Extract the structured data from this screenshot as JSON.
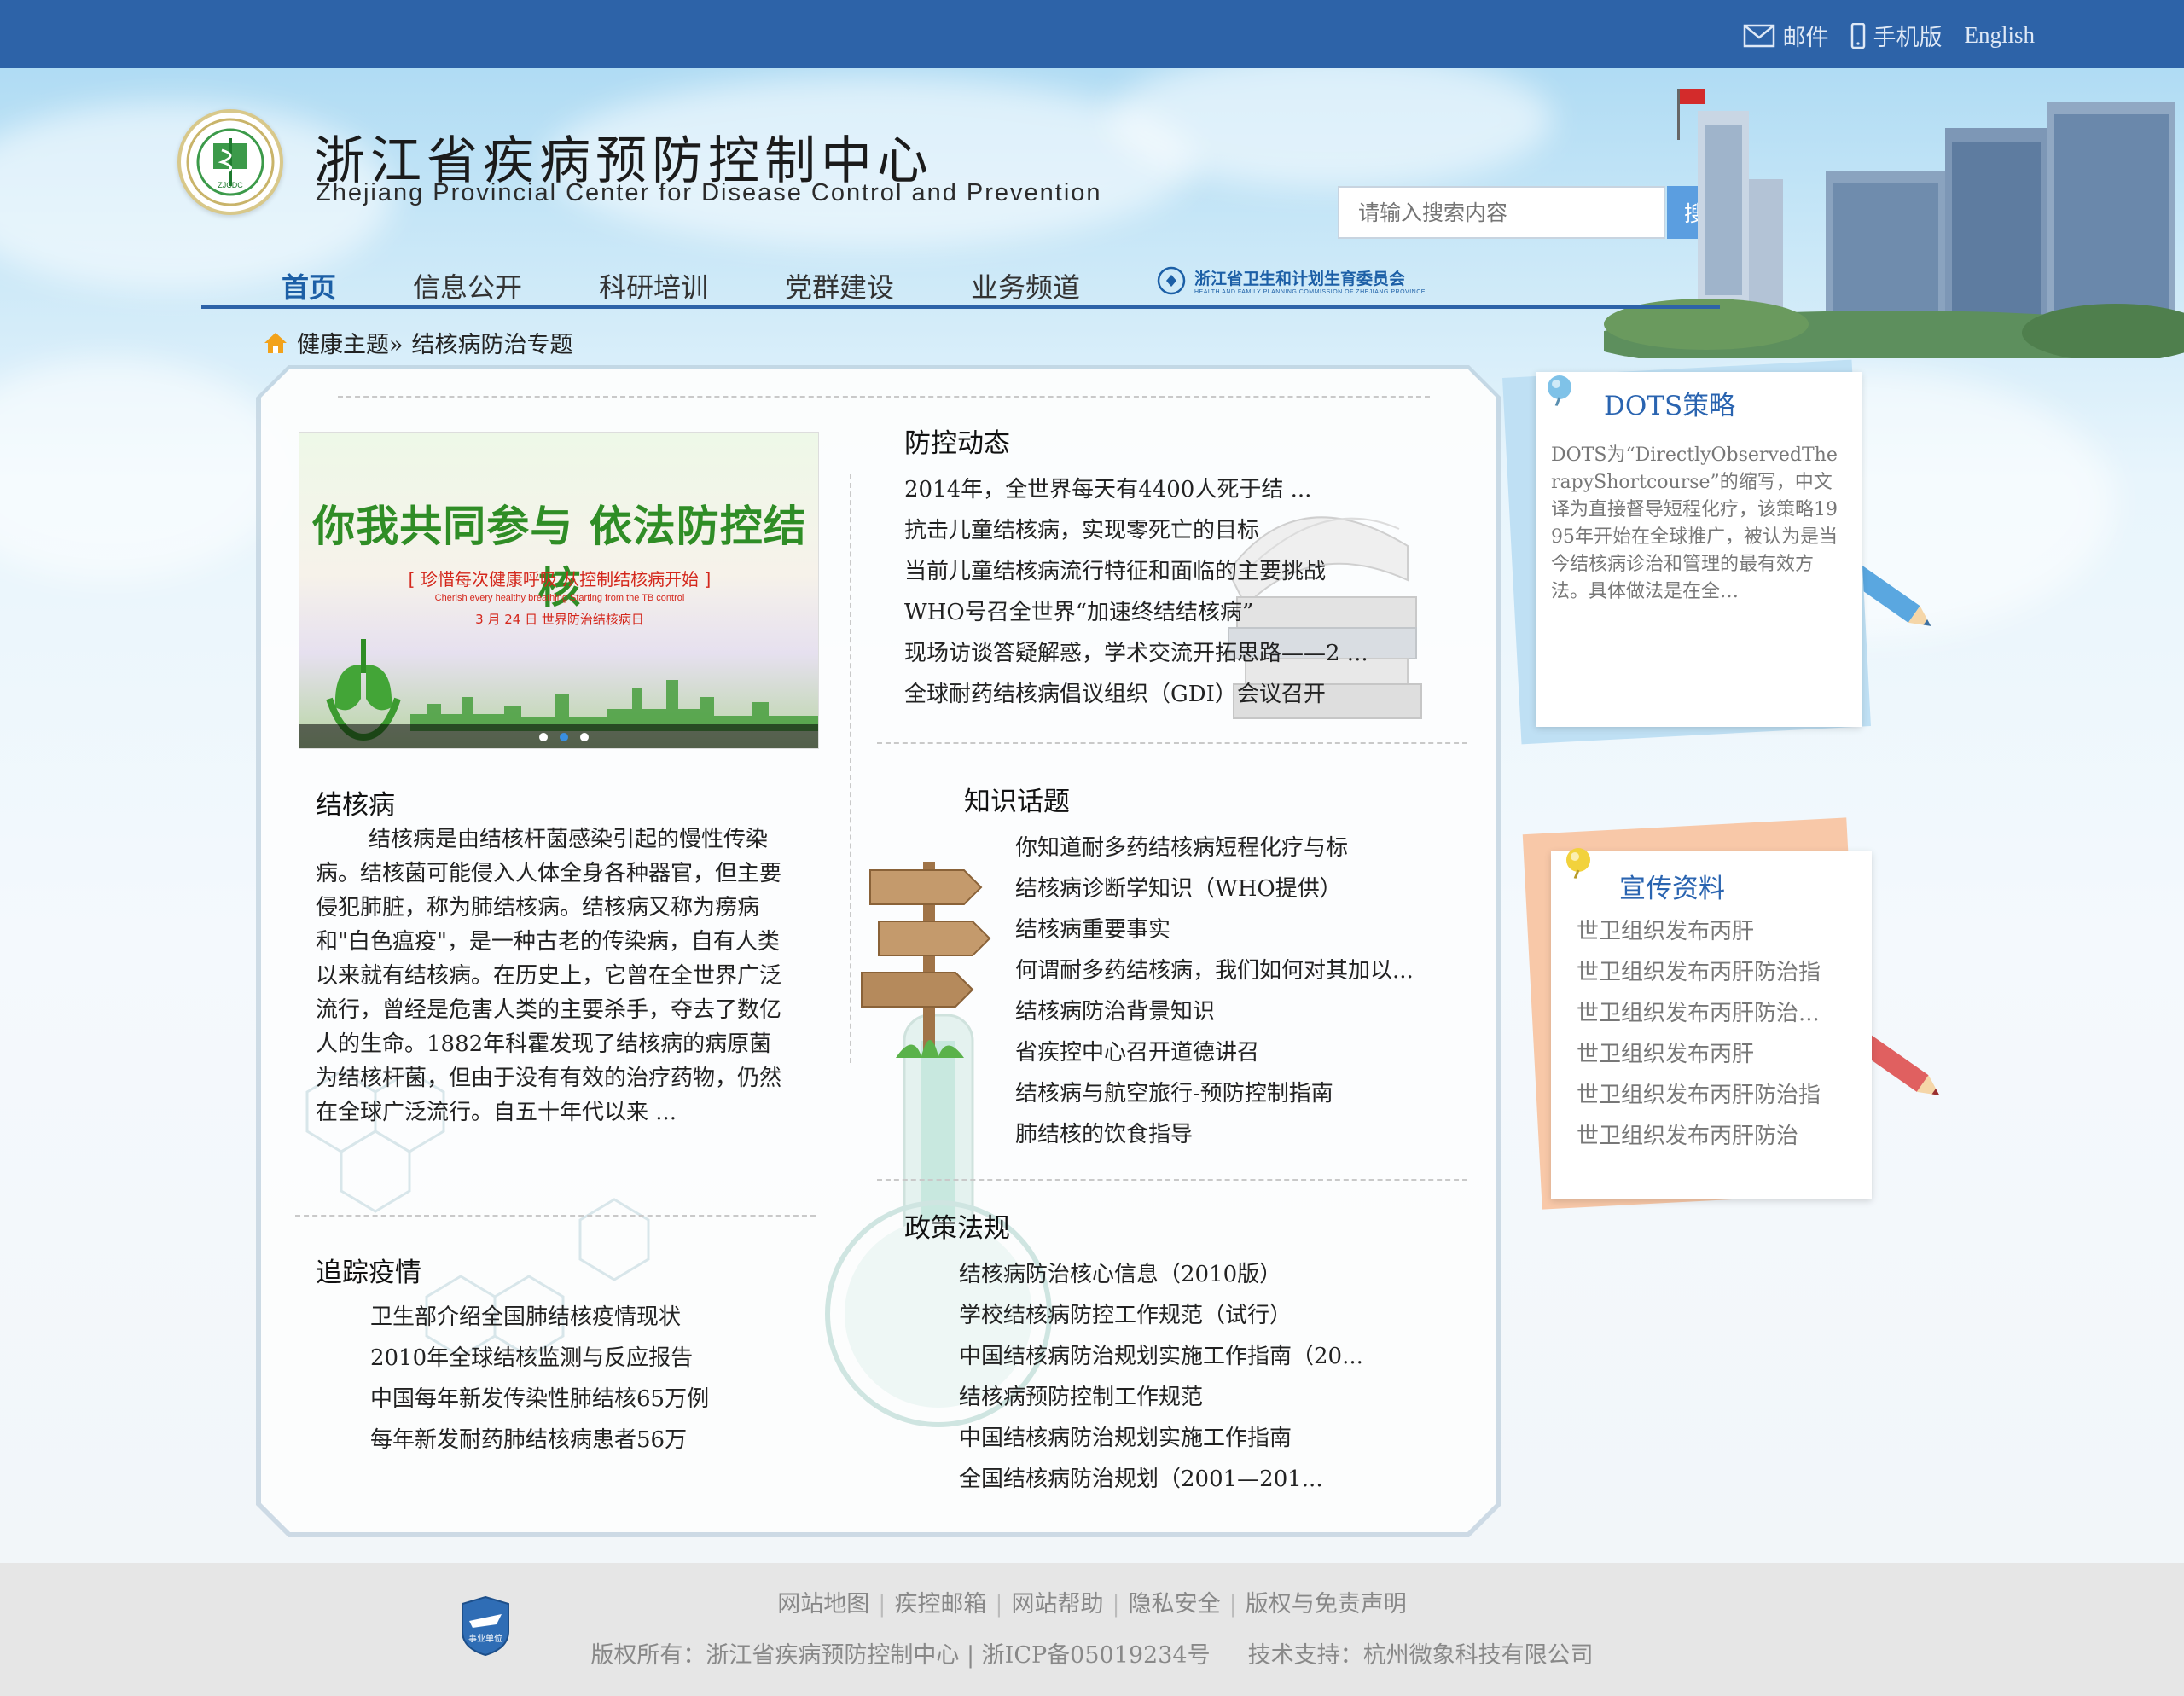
{
  "header": {
    "top_links": {
      "mail": "邮件",
      "mobile": "手机版",
      "english": "English"
    },
    "title_cn": "浙江省疾病预防控制中心",
    "title_en": "Zhejiang Provincial Center for Disease Control and Prevention",
    "logo_text": "ZJCDC",
    "search": {
      "placeholder": "请输入搜索内容",
      "button": "搜索"
    }
  },
  "nav": {
    "items": [
      "首页",
      "信息公开",
      "科研培训",
      "党群建设",
      "业务频道"
    ],
    "active_index": 0,
    "commission_cn": "浙江省卫生和计划生育委员会",
    "commission_en": "HEALTH AND FAMILY PLANNING COMMISSION OF ZHEJIANG PROVINCE"
  },
  "breadcrumb": {
    "parent": "健康主题»",
    "current": "结核病防治专题"
  },
  "banner": {
    "title": "你我共同参与 依法防控结核",
    "subtitle": "[ 珍惜每次健康呼吸  从控制结核病开始 ]",
    "subtitle_en": "Cherish every healthy breathing Starting from the TB control",
    "date": "3 月 24 日 世界防治结核病日"
  },
  "tb_intro": {
    "title": "结核病",
    "text": "结核病是由结核杆菌感染引起的慢性传染病。结核菌可能侵入人体全身各种器官，但主要侵犯肺脏，称为肺结核病。结核病又称为痨病和\"白色瘟疫\"，是一种古老的传染病，自有人类以来就有结核病。在历史上，它曾在全世界广泛流行，曾经是危害人类的主要杀手，夺去了数亿人的生命。1882年科霍发现了结核病的病原菌为结核杆菌，但由于没有有效的治疗药物，仍然在全球广泛流行。自五十年代以来 ..."
  },
  "epidemic": {
    "title": "追踪疫情",
    "items": [
      "卫生部介绍全国肺结核疫情现状",
      "2010年全球结核监测与反应报告",
      "中国每年新发传染性肺结核65万例",
      "每年新发耐药肺结核病患者56万"
    ]
  },
  "news": {
    "title": "防控动态",
    "items": [
      "2014年，全世界每天有4400人死于结 ...",
      "抗击儿童结核病，实现零死亡的目标",
      "当前儿童结核病流行特征和面临的主要挑战",
      "WHO号召全世界“加速终结结核病”",
      "现场访谈答疑解惑，学术交流开拓思路——2 ...",
      "全球耐药结核病倡议组织（GDI）会议召开"
    ]
  },
  "knowledge": {
    "title": "知识话题",
    "items": [
      "你知道耐多药结核病短程化疗与标",
      "结核病诊断学知识（WHO提供）",
      "结核病重要事实",
      "何谓耐多药结核病，我们如何对其加以...",
      "结核病防治背景知识",
      "省疾控中心召开道德讲召",
      "结核病与航空旅行-预防控制指南",
      "肺结核的饮食指导"
    ]
  },
  "policy": {
    "title": "政策法规",
    "items": [
      "结核病防治核心信息（2010版）",
      "学校结核病防控工作规范（试行）",
      "中国结核病防治规划实施工作指南（20...",
      "结核病预防控制工作规范",
      " 中国结核病防治规划实施工作指南",
      "全国结核病防治规划（2001—201..."
    ]
  },
  "dots": {
    "title": "DOTS策略",
    "text": "DOTS为“DirectlyObservedTherapyShortcourse”的缩写，中文译为直接督导短程化疗，该策略1995年开始在全球推广，被认为是当今结核病诊治和管理的最有效方法。具体做法是在全…"
  },
  "publicity": {
    "title": "宣传资料",
    "items": [
      "世卫组织发布丙肝",
      "世卫组织发布丙肝防治指",
      "世卫组织发布丙肝防治...",
      "世卫组织发布丙肝",
      "世卫组织发布丙肝防治指",
      "世卫组织发布丙肝防治"
    ]
  },
  "footer": {
    "links": [
      "网站地图",
      "疾控邮箱",
      "网站帮助",
      "隐私安全",
      "版权与免责声明"
    ],
    "copyright": "版权所有：浙江省疾病预防控制中心 | 浙ICP备05019234号",
    "support": "技术支持：杭州微象科技有限公司",
    "badge": "事业单位"
  },
  "colors": {
    "brand_blue": "#2d63a8",
    "link_blue": "#2a64b0",
    "banner_green": "#2f8d26",
    "banner_red": "#d4271c"
  }
}
